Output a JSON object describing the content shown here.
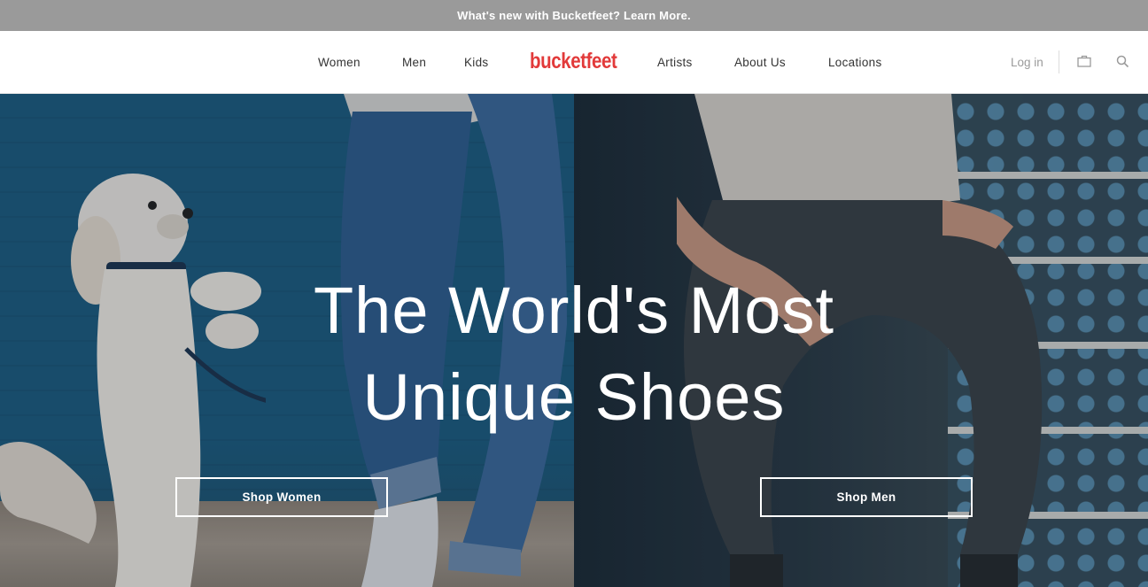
{
  "announcement": {
    "text": "What's new with Bucketfeet? Learn More."
  },
  "nav": {
    "left": [
      {
        "label": "Women"
      },
      {
        "label": "Men"
      },
      {
        "label": "Kids"
      }
    ],
    "logo": "bucketfeet",
    "right": [
      {
        "label": "Artists"
      },
      {
        "label": "About Us"
      },
      {
        "label": "Locations"
      }
    ],
    "login": "Log in",
    "icons": [
      "bag-icon",
      "search-icon"
    ]
  },
  "hero": {
    "headline_line1": "The World's Most",
    "headline_line2": "Unique Shoes",
    "shop_women": "Shop Women",
    "shop_men": "Shop Men"
  },
  "colors": {
    "brand": "#e23a3a",
    "announcement_bg": "#9a9a9a"
  }
}
